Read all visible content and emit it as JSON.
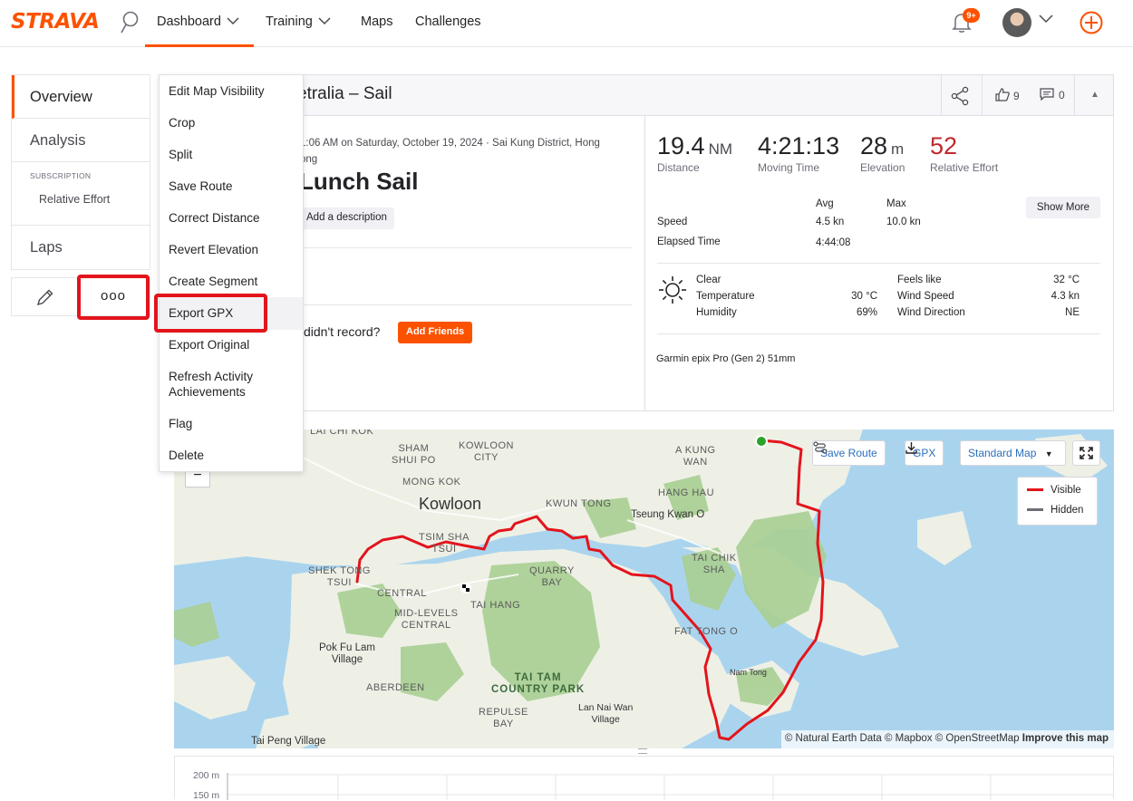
{
  "nav": {
    "logo": "STRAVA",
    "items": [
      "Dashboard",
      "Training",
      "Maps",
      "Challenges"
    ],
    "notif_badge": "9+"
  },
  "sidebar": {
    "overview": "Overview",
    "analysis": "Analysis",
    "subscription_caption": "SUBSCRIPTION",
    "relative_effort": "Relative Effort",
    "laps": "Laps",
    "more_dots": "ooo"
  },
  "menu": {
    "items": [
      "Edit Map Visibility",
      "Crop",
      "Split",
      "Save Route",
      "Correct Distance",
      "Revert Elevation",
      "Create Segment",
      "Export GPX",
      "Export Original",
      "Refresh Activity Achievements",
      "Flag",
      "Delete"
    ],
    "highlighted": "Export GPX"
  },
  "activity": {
    "header_title": "etralia – Sail",
    "kudos": "9",
    "comments": "0",
    "datetime": "1:06 AM on Saturday, October 19, 2024 · Sai Kung District, Hong Kong",
    "datetime_line1": "1:06 AM on Saturday, October 19, 2024 · Sai Kung District, Hong",
    "datetime_line2": "ong",
    "name": "Lunch Sail",
    "add_description": "Add a description",
    "friends_question": "didn't record?",
    "add_friends": "Add Friends"
  },
  "stats": {
    "distance": {
      "value": "19.4",
      "unit": "NM",
      "label": "Distance"
    },
    "moving_time": {
      "value": "4:21:13",
      "label": "Moving Time"
    },
    "elevation": {
      "value": "28",
      "unit": "m",
      "label": "Elevation"
    },
    "relative_effort": {
      "value": "52",
      "label": "Relative Effort"
    }
  },
  "table": {
    "avg_header": "Avg",
    "max_header": "Max",
    "speed_label": "Speed",
    "speed_avg": "4.5 kn",
    "speed_max": "10.0 kn",
    "elapsed_label": "Elapsed Time",
    "elapsed_value": "4:44:08",
    "show_more": "Show More"
  },
  "weather": {
    "condition": "Clear",
    "temperature_label": "Temperature",
    "temperature": "30 °C",
    "humidity_label": "Humidity",
    "humidity": "69%",
    "feels_like_label": "Feels like",
    "feels_like": "32 °C",
    "wind_speed_label": "Wind Speed",
    "wind_speed": "4.3 kn",
    "wind_dir_label": "Wind Direction",
    "wind_dir": "NE"
  },
  "device": "Garmin epix Pro (Gen 2) 51mm",
  "map": {
    "save_route": "Save Route",
    "gpx": "GPX",
    "style": "Standard Map",
    "legend_visible": "Visible",
    "legend_hidden": "Hidden",
    "attrib_text": "© Natural Earth Data © Mapbox © OpenStreetMap",
    "attrib_link": "Improve this map",
    "labels": {
      "sham_shui_po": "SHAM\nSHUI PO",
      "kowloon_city": "KOWLOON\nCITY",
      "mong_kok": "MONG KOK",
      "kowloon": "Kowloon",
      "kwun_tong": "KWUN TONG",
      "a_kung_wan": "A KUNG\nWAN",
      "hang_hau": "HANG HAU",
      "tseung_kwan_o": "Tseung Kwan O",
      "tsim_sha_tsui": "TSIM SHA\nTSUI",
      "tai_chik_sha": "TAI CHIK\nSHA",
      "shek_tong_tsui": "SHEK TONG\nTSUI",
      "quarry_bay": "QUARRY\nBAY",
      "central": "CENTRAL",
      "tai_hang": "TAI HANG",
      "mid_levels": "MID-LEVELS\nCENTRAL",
      "fat_tong_o": "FAT TONG O",
      "pok_fu_lam": "Pok Fu Lam\nVillage",
      "aberdeen": "ABERDEEN",
      "tai_tam": "TAI TAM\nCOUNTRY PARK",
      "nam_tong": "Nam Tong",
      "repulse_bay": "REPULSE\nBAY",
      "lan_nai_wan": "Lan Nai Wan\nVillage",
      "tai_peng": "Tai Peng Village",
      "lai_chi_kok": "LAI CHI KOK"
    }
  },
  "elevation_axis": [
    "200 m",
    "150 m"
  ],
  "colors": {
    "brand": "#fc5200",
    "route": "#e3141c",
    "effort": "#c0282d"
  }
}
